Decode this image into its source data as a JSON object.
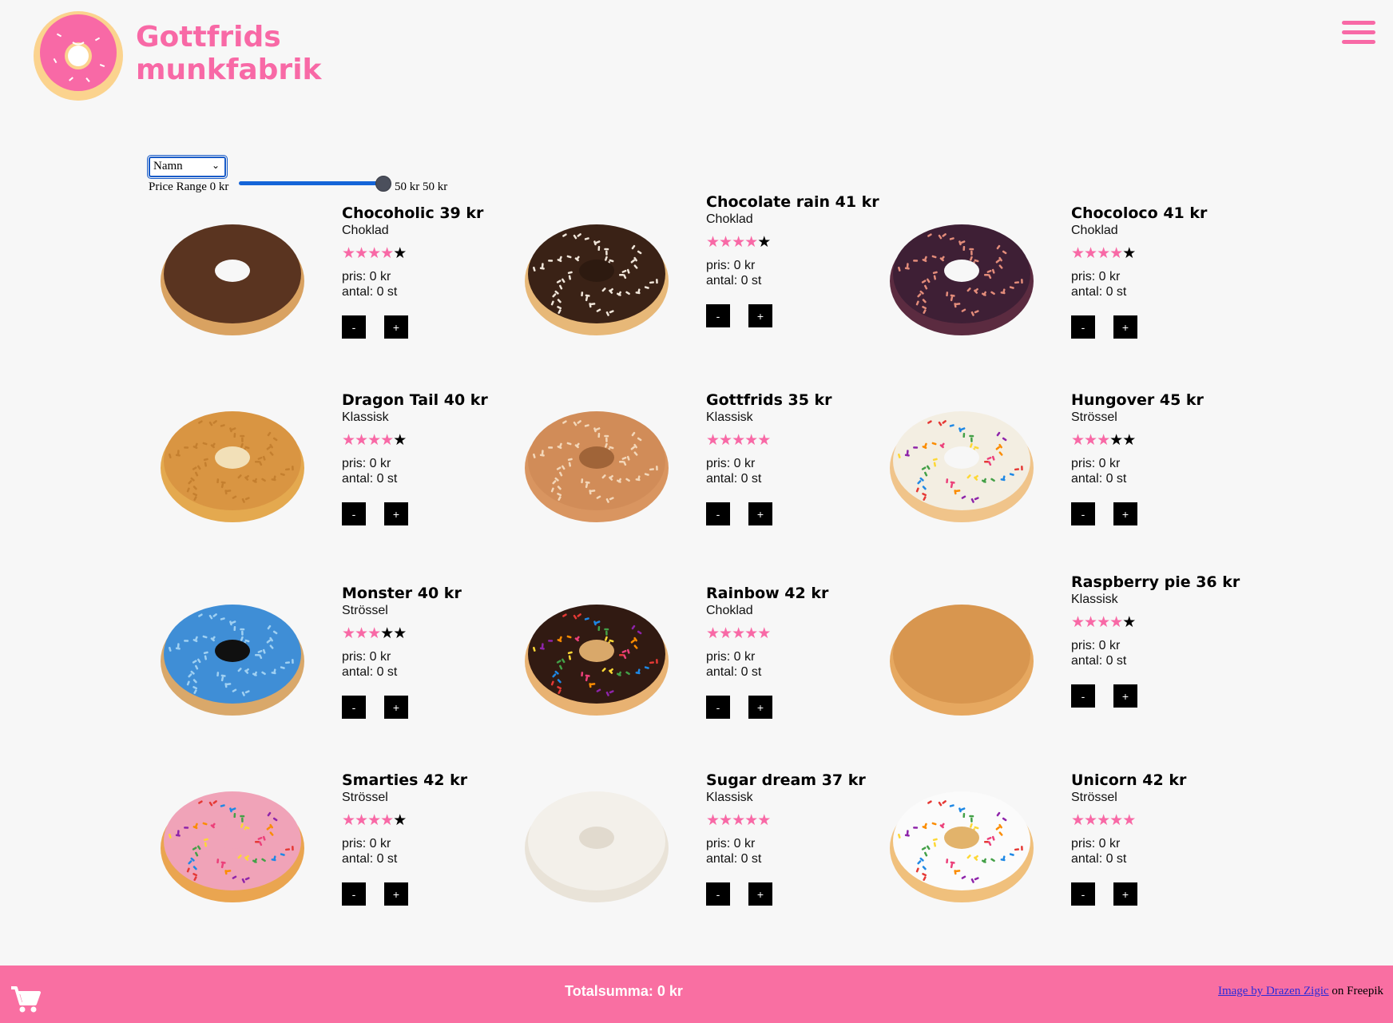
{
  "brand": {
    "line1": "Gottfrids",
    "line2": "munkfabrik",
    "color": "#f869a6"
  },
  "menu_icon": "hamburger-icon",
  "controls": {
    "sort_value": "Namn",
    "price_label": "Price Range 0 kr",
    "price_value": "50 kr 50 kr",
    "price_fraction": 1.0
  },
  "products": [
    {
      "title": "Chocoholic 39 kr",
      "category": "Choklad",
      "rating": 4,
      "price": "pris: 0 kr",
      "qty": "antal: 0 st",
      "style": "chocolate-glaze"
    },
    {
      "title": "Chocolate rain 41 kr",
      "category": "Choklad",
      "rating": 4,
      "price": "pris: 0 kr",
      "qty": "antal: 0 st",
      "style": "chocolate-sprinkles"
    },
    {
      "title": "Chocoloco 41 kr",
      "category": "Choklad",
      "rating": 4,
      "price": "pris: 0 kr",
      "qty": "antal: 0 st",
      "style": "dark-chocolate-bits"
    },
    {
      "title": "Dragon Tail 40 kr",
      "category": "Klassisk",
      "rating": 4,
      "price": "pris: 0 kr",
      "qty": "antal: 0 st",
      "style": "coconut-crumb"
    },
    {
      "title": "Gottfrids 35 kr",
      "category": "Klassisk",
      "rating": 5,
      "price": "pris: 0 kr",
      "qty": "antal: 0 st",
      "style": "sugar"
    },
    {
      "title": "Hungover 45 kr",
      "category": "Strössel",
      "rating": 3,
      "price": "pris: 0 kr",
      "qty": "antal: 0 st",
      "style": "rainbow-chocolate"
    },
    {
      "title": "Monster 40 kr",
      "category": "Strössel",
      "rating": 3,
      "price": "pris: 0 kr",
      "qty": "antal: 0 st",
      "style": "blue-monster"
    },
    {
      "title": "Rainbow 42 kr",
      "category": "Choklad",
      "rating": 5,
      "price": "pris: 0 kr",
      "qty": "antal: 0 st",
      "style": "chocolate-rainbow"
    },
    {
      "title": "Raspberry pie 36 kr",
      "category": "Klassisk",
      "rating": 4,
      "price": "pris: 0 kr",
      "qty": "antal: 0 st",
      "style": "filled"
    },
    {
      "title": "Smarties 42 kr",
      "category": "Strössel",
      "rating": 4,
      "price": "pris: 0 kr",
      "qty": "antal: 0 st",
      "style": "pink-smarties"
    },
    {
      "title": "Sugar dream 37 kr",
      "category": "Klassisk",
      "rating": 5,
      "price": "pris: 0 kr",
      "qty": "antal: 0 st",
      "style": "powdered"
    },
    {
      "title": "Unicorn 42 kr",
      "category": "Strössel",
      "rating": 5,
      "price": "pris: 0 kr",
      "qty": "antal: 0 st",
      "style": "white-sprinkles"
    }
  ],
  "buttons": {
    "minus": "-",
    "plus": "+"
  },
  "footer": {
    "total": "Totalsumma: 0 kr",
    "credit_link": "Image by Drazen Zigic",
    "credit_suffix": " on Freepik",
    "cart_icon": "cart-icon",
    "color": "#f96fa2"
  }
}
